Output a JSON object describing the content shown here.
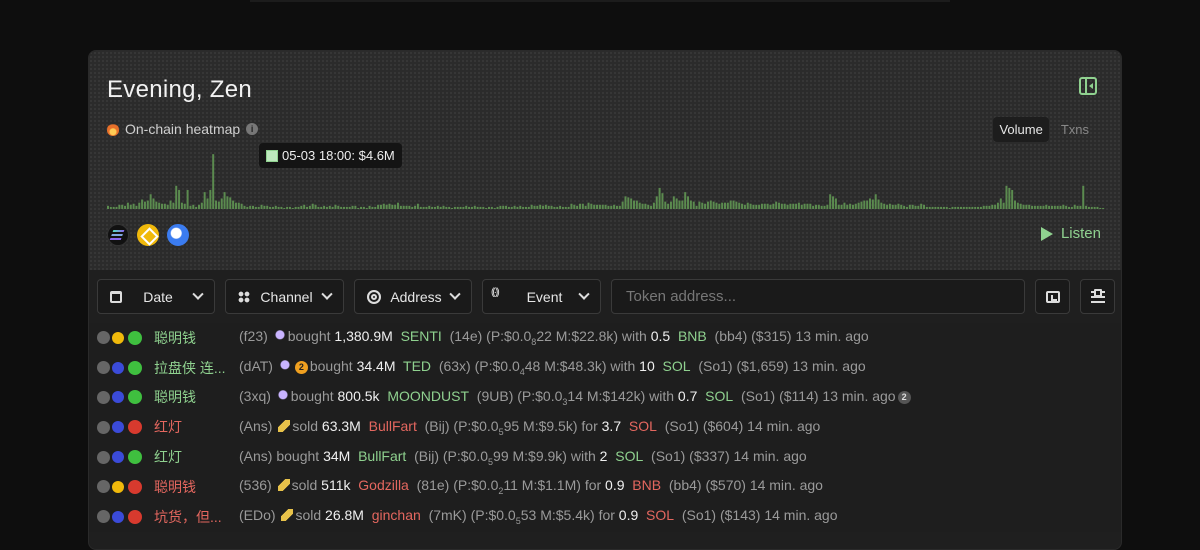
{
  "header": {
    "greeting": "Evening, Zen",
    "heatmap_label": "On-chain heatmap",
    "tabs": [
      {
        "label": "Volume",
        "active": true
      },
      {
        "label": "Txns",
        "active": false
      }
    ],
    "tooltip": "05-03 18:00: $4.6M",
    "listen_label": "Listen"
  },
  "chart_data": {
    "type": "bar",
    "title": "",
    "xlabel": "",
    "ylabel": "",
    "series": [
      {
        "values": [
          3,
          2,
          2,
          2,
          4,
          4,
          3,
          6,
          4,
          5,
          3,
          6,
          9,
          7,
          8,
          14,
          10,
          7,
          6,
          5,
          5,
          4,
          8,
          6,
          22,
          18,
          6,
          5,
          18,
          3,
          4,
          2,
          4,
          6,
          16,
          10,
          18,
          52,
          8,
          7,
          10,
          16,
          12,
          11,
          8,
          6,
          6,
          5,
          3,
          2,
          3,
          3,
          2,
          2,
          4,
          3,
          3,
          2,
          2,
          3,
          2,
          2,
          1,
          2,
          2,
          1,
          2,
          2,
          3,
          4,
          2,
          3,
          5,
          4,
          2,
          2,
          3,
          2,
          3,
          2,
          4,
          3,
          2,
          2,
          2,
          2,
          3,
          3,
          1,
          2,
          2,
          1,
          3,
          2,
          2,
          4,
          4,
          5,
          4,
          5,
          4,
          4,
          6,
          3,
          3,
          3,
          3,
          2,
          3,
          5,
          2,
          2,
          2,
          3,
          2,
          2,
          3,
          2,
          3,
          2,
          2,
          1,
          2,
          2,
          2,
          2,
          3,
          2,
          2,
          3,
          2,
          2,
          2,
          1,
          2,
          2,
          1,
          2,
          3,
          3,
          3,
          2,
          2,
          3,
          2,
          3,
          2,
          2,
          2,
          4,
          3,
          3,
          4,
          3,
          4,
          3,
          3,
          2,
          2,
          3,
          2,
          2,
          2,
          5,
          4,
          3,
          5,
          5,
          3,
          6,
          5,
          4,
          4,
          4,
          4,
          4,
          3,
          3,
          4,
          3,
          3,
          7,
          12,
          11,
          10,
          8,
          8,
          6,
          5,
          5,
          4,
          3,
          6,
          12,
          20,
          15,
          7,
          5,
          7,
          12,
          10,
          8,
          8,
          16,
          12,
          8,
          7,
          3,
          7,
          6,
          5,
          7,
          8,
          7,
          6,
          5,
          6,
          6,
          6,
          8,
          8,
          7,
          6,
          5,
          4,
          6,
          5,
          4,
          4,
          4,
          5,
          5,
          5,
          4,
          5,
          7,
          6,
          5,
          5,
          4,
          5,
          5,
          5,
          6,
          4,
          5,
          5,
          5,
          3,
          4,
          4,
          3,
          3,
          4,
          14,
          12,
          10,
          4,
          4,
          6,
          4,
          5,
          4,
          5,
          6,
          7,
          8,
          8,
          10,
          9,
          14,
          9,
          6,
          5,
          4,
          5,
          4,
          4,
          5,
          4,
          3,
          2,
          4,
          4,
          3,
          3,
          5,
          4,
          2,
          2,
          2,
          2,
          2,
          2,
          2,
          2,
          1,
          2,
          2,
          2,
          2,
          2,
          2,
          2,
          2,
          2,
          2,
          2,
          3,
          3,
          3,
          4,
          4,
          6,
          10,
          6,
          22,
          20,
          18,
          8,
          6,
          5,
          4,
          4,
          4,
          3,
          3,
          3,
          3,
          3,
          4,
          3,
          3,
          3,
          3,
          3,
          4,
          3,
          2,
          2,
          4,
          3,
          3,
          22,
          3,
          2,
          2,
          2,
          2,
          1,
          1
        ],
        "max": 55
      }
    ],
    "tooltip": {
      "x": "05-03 18:00",
      "value": "$4.6M"
    }
  },
  "chains": [
    "solana-icon",
    "bnb-icon",
    "base-icon"
  ],
  "filters": {
    "date": "Date",
    "channel": "Channel",
    "address": "Address",
    "event": "Event",
    "token_placeholder": "Token address..."
  },
  "feed": [
    {
      "name": "聪明钱",
      "id": "(f23)",
      "action": "bought",
      "amount": "1,380.9M",
      "token": "SENTI",
      "tid": "(14e)",
      "p1": "(P:$0.0",
      "p2": "8",
      "p3": "22 M:$22.8k)",
      "prep": "with",
      "qty": "0.5",
      "chain": "BNB",
      "cid": "(bb4)",
      "usd": "($315)",
      "time": "13 min. ago",
      "side": "buy",
      "chainIcon": "bnb",
      "extra": "",
      "emoji": "ghost"
    },
    {
      "name": "拉盘侠 连...",
      "id": "(dAT)",
      "action": "bought",
      "amount": "34.4M",
      "token": "TED",
      "tid": "(63x)",
      "p1": "(P:$0.0",
      "p2": "4",
      "p3": "48 M:$48.3k)",
      "prep": "with",
      "qty": "10",
      "chain": "SOL",
      "cid": "(So1)",
      "usd": "($1,659)",
      "time": "13 min. ago",
      "side": "buy",
      "chainIcon": "sol",
      "extra": "2",
      "emoji": "ghost"
    },
    {
      "name": "聪明钱",
      "id": "(3xq)",
      "action": "bought",
      "amount": "800.5k",
      "token": "MOONDUST",
      "tid": "(9UB)",
      "p1": "(P:$0.0",
      "p2": "3",
      "p3": "14 M:$142k)",
      "prep": "with",
      "qty": "0.7",
      "chain": "SOL",
      "cid": "(So1)",
      "usd": "($114)",
      "time": "13 min. ago",
      "side": "buy",
      "chainIcon": "sol",
      "extra": "2",
      "emoji": "ghost",
      "badgeEnd": true
    },
    {
      "name": "红灯",
      "id": "(Ans)",
      "action": "sold",
      "amount": "63.3M",
      "token": "BullFart",
      "tid": "(Bij)",
      "p1": "(P:$0.0",
      "p2": "5",
      "p3": "95 M:$9.5k)",
      "prep": "for",
      "qty": "3.7",
      "chain": "SOL",
      "cid": "(So1)",
      "usd": "($604)",
      "time": "14 min. ago",
      "side": "sell",
      "chainIcon": "sol",
      "extra": "",
      "emoji": "bottle"
    },
    {
      "name": "红灯",
      "id": "(Ans)",
      "action": "bought",
      "amount": "34M",
      "token": "BullFart",
      "tid": "(Bij)",
      "p1": "(P:$0.0",
      "p2": "5",
      "p3": "99 M:$9.9k)",
      "prep": "with",
      "qty": "2",
      "chain": "SOL",
      "cid": "(So1)",
      "usd": "($337)",
      "time": "14 min. ago",
      "side": "buy",
      "chainIcon": "sol",
      "extra": "",
      "emoji": ""
    },
    {
      "name": "聪明钱",
      "id": "(536)",
      "action": "sold",
      "amount": "511k",
      "token": "Godzilla",
      "tid": "(81e)",
      "p1": "(P:$0.0",
      "p2": "2",
      "p3": "11 M:$1.1M)",
      "prep": "for",
      "qty": "0.9",
      "chain": "BNB",
      "cid": "(bb4)",
      "usd": "($570)",
      "time": "14 min. ago",
      "side": "sell",
      "chainIcon": "bnb",
      "extra": "",
      "emoji": "bottle"
    },
    {
      "name": "坑货，但...",
      "id": "(EDo)",
      "action": "sold",
      "amount": "26.8M",
      "token": "ginchan",
      "tid": "(7mK)",
      "p1": "(P:$0.0",
      "p2": "5",
      "p3": "53 M:$5.4k)",
      "prep": "for",
      "qty": "0.9",
      "chain": "SOL",
      "cid": "(So1)",
      "usd": "($143)",
      "time": "14 min. ago",
      "side": "sell",
      "chainIcon": "sol",
      "extra": "",
      "emoji": "bottle"
    }
  ],
  "colors": {
    "buy": "#8fd18f",
    "sell": "#e4675f",
    "bar": "#5b8b4f",
    "bnb": "#f0b90b",
    "sol": "#3b4bd8"
  }
}
